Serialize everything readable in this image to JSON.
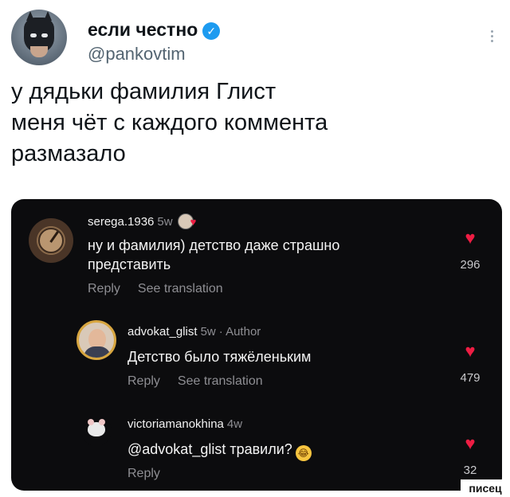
{
  "author": {
    "display_name": "если честно",
    "handle": "@pankovtim",
    "verified_icon": "verified-badge-icon"
  },
  "tweet": {
    "lines": [
      "у дядьки фамилия Глист",
      "меня чёт с каждого коммента",
      "размазало"
    ]
  },
  "comments": [
    {
      "username": "serega.1936",
      "age": "5w",
      "author_tag": "",
      "text_lines": [
        "ну и фамилия) детство даже страшно",
        "представить"
      ],
      "reply_label": "Reply",
      "translation_label": "See translation",
      "likes": "296"
    },
    {
      "username": "advokat_glist",
      "age": "5w",
      "author_tag": "· Author",
      "text_lines": [
        "Детство было тяжёленьким"
      ],
      "reply_label": "Reply",
      "translation_label": "See translation",
      "likes": "479"
    },
    {
      "username": "victoriamanokhina",
      "age": "4w",
      "author_tag": "",
      "text_lines": [
        "@advokat_glist травили?"
      ],
      "reply_label": "Reply",
      "translation_label": "",
      "likes": "32"
    }
  ],
  "colors": {
    "card_background": "#0c0c0e",
    "heart": "#ee1d43",
    "verified": "#1d9bf0"
  },
  "watermark": "писец"
}
